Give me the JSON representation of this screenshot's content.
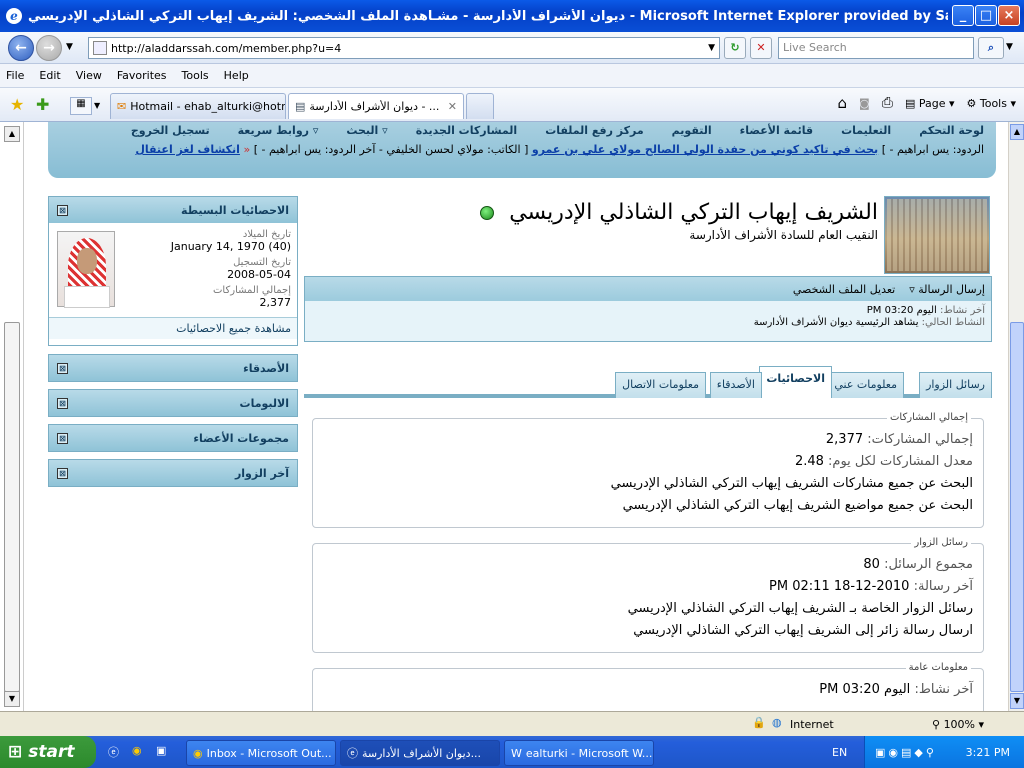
{
  "window": {
    "title": "ديوان الأشراف الأدارسة - مشـاهدة الملف الشخصي: الشريف إيهاب التركي الشاذلي الإدريسي - Microsoft Internet Explorer provided by Sa"
  },
  "browser": {
    "address": "http://aladdarssah.com/member.php?u=4",
    "search_placeholder": "Live Search",
    "menu": [
      "File",
      "Edit",
      "View",
      "Favorites",
      "Tools",
      "Help"
    ],
    "tabs": [
      {
        "label": "Hotmail - ehab_alturki@hotm..."
      },
      {
        "label": "ديوان الأشراف الأدارسة - ..."
      }
    ],
    "cmd": {
      "page": "Page",
      "tools": "Tools"
    }
  },
  "site_nav": {
    "links": [
      "لوحة التحكم",
      "التعليمات",
      "قائمة الأعضاء",
      "التقويم",
      "مركز رفع الملفات",
      "المشاركات الجديدة",
      "البحث",
      "روابط سريعة",
      "تسجيل الخروج"
    ],
    "ticker_prefix": "الردود: يس ابراهيم - ]",
    "ticker_link1": "بحث في تاكيد كوني من حفدة الولي الصالح مولاي علي بن عمرو",
    "ticker_mid": "[ الكاتب: مولاي لحسن الخليفي - آخر الردود: يس ابراهيم - ]",
    "ticker_link2": "انكشاف لغز اعتقال"
  },
  "stats_panel": {
    "title": "الاحصائيات البسيطة",
    "birth_label": "تاريخ الميلاد",
    "birth_value": "January 14, 1970 (40)",
    "reg_label": "تاريخ التسجيل",
    "reg_value": "2008-05-04",
    "posts_label": "إجمالي المشاركات",
    "posts_value": "2,377",
    "footer": "مشاهدة جميع الاحصائيات"
  },
  "side_panels": [
    "الأصدقاء",
    "الالبومات",
    "مجموعات الأعضاء",
    "آخر الزوار"
  ],
  "profile": {
    "name": "الشريف إيهاب التركي الشاذلي الإدريسي",
    "subtitle": "النقيب العام للسادة الأشراف الأدارسة",
    "send_message": "إرسال الرسالة",
    "edit_profile": "تعديل الملف الشخصي",
    "last_activity_label": "آخر نشاط:",
    "last_activity_value": "اليوم 03:20 PM",
    "current_activity_label": "النشاط الحالي:",
    "current_activity_value": "يشاهد الرئيسية ديوان الأشراف الأدارسة"
  },
  "profile_tabs": [
    "رسائل الزوار",
    "معلومات عني",
    "الاحصائيات",
    "الأصدقاء",
    "معلومات الاتصال"
  ],
  "post_stats": {
    "legend": "إجمالي المشاركات",
    "total_label": "إجمالي المشاركات:",
    "total_value": "2,377",
    "per_day_label": "معدل المشاركات لكل يوم:",
    "per_day_value": "2.48",
    "search_posts": "البحث عن جميع مشاركات الشريف إيهاب التركي الشاذلي الإدريسي",
    "search_threads": "البحث عن جميع مواضيع الشريف إيهاب التركي الشاذلي الإدريسي"
  },
  "visitor_messages": {
    "legend": "رسائل الزوار",
    "total_label": "مجموع الرسائل:",
    "total_value": "80",
    "last_label": "آخر رسالة:",
    "last_value": "2010-12-18 02:11 PM",
    "link1": "رسائل الزوار الخاصة بـ الشريف إيهاب التركي الشاذلي الإدريسي",
    "link2": "ارسال رسالة زائر إلى الشريف إيهاب التركي الشاذلي الإدريسي"
  },
  "general_info": {
    "legend": "معلومات عامة",
    "last_label": "آخر نشاط:",
    "last_value": "اليوم 03:20 PM"
  },
  "statusbar": {
    "zone": "Internet",
    "zoom": "100%"
  },
  "taskbar": {
    "start": "start",
    "tasks": [
      "Inbox - Microsoft Out...",
      "ديوان الأشراف الأدارسة...",
      "ealturki - Microsoft W..."
    ],
    "lang": "EN",
    "clock": "3:21 PM"
  }
}
